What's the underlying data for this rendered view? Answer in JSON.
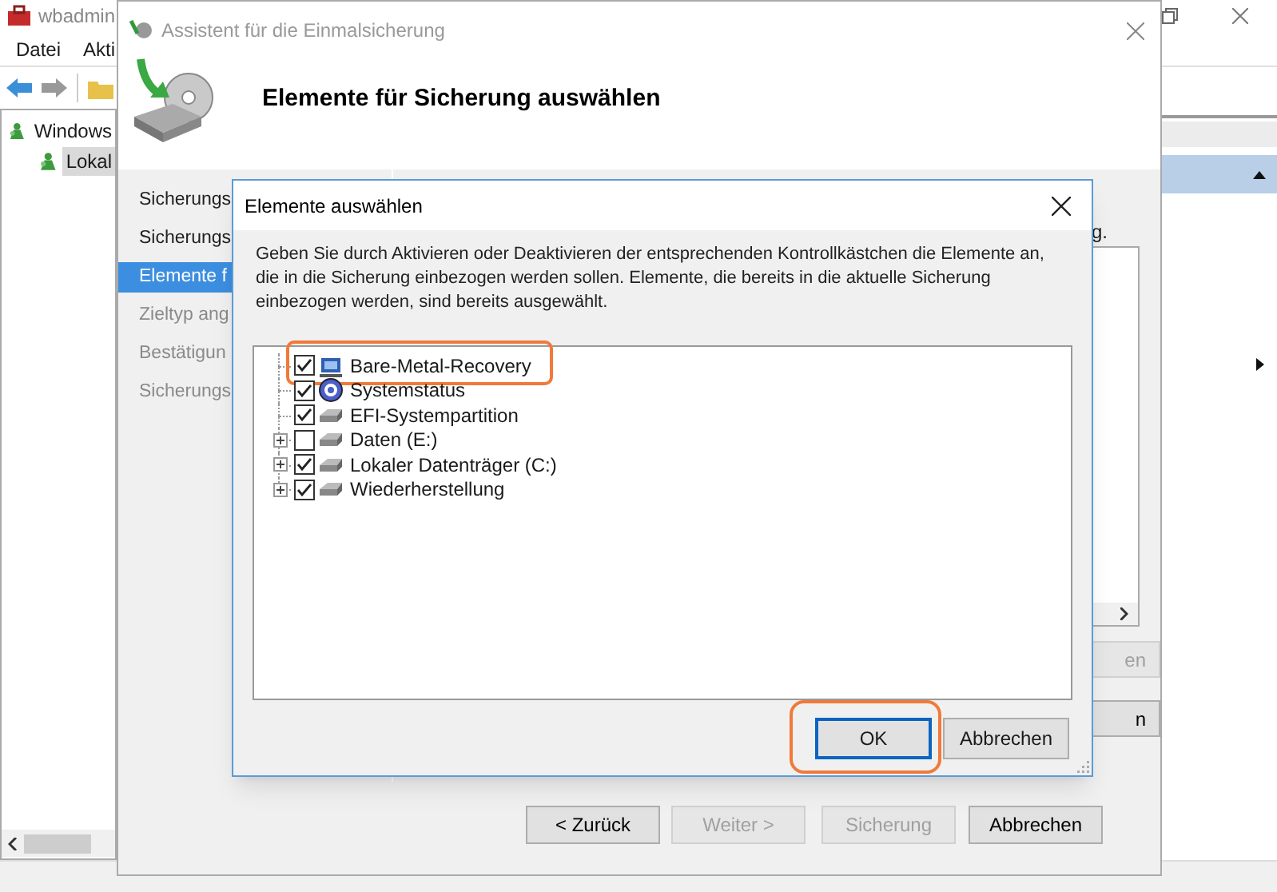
{
  "main_window": {
    "title": "wbadmin",
    "menu": [
      "Datei",
      "Akti"
    ],
    "tree": [
      {
        "label": "Windows",
        "selected": false,
        "children": [
          {
            "label": "Lokal",
            "selected": true
          }
        ]
      }
    ]
  },
  "wizard": {
    "title": "Assistent für die Einmalsicherung",
    "heading": "Elemente für Sicherung auswählen",
    "steps": [
      {
        "label": "Sicherungs",
        "selected": false,
        "disabled": false
      },
      {
        "label": "Sicherungs",
        "selected": false,
        "disabled": false
      },
      {
        "label": "Elemente f",
        "selected": true,
        "disabled": false
      },
      {
        "label": "Zieltyp ang",
        "selected": false,
        "disabled": true
      },
      {
        "label": "Bestätigun",
        "selected": false,
        "disabled": true
      },
      {
        "label": "Sicherungs",
        "selected": false,
        "disabled": true
      }
    ],
    "content_text": "g.",
    "side_buttons": [
      {
        "label": "en",
        "disabled": true
      },
      {
        "label": "n",
        "disabled": false
      }
    ],
    "buttons": [
      {
        "label": "< Zurück",
        "disabled": false
      },
      {
        "label": "Weiter >",
        "disabled": true
      },
      {
        "label": "Sicherung",
        "disabled": true
      },
      {
        "label": "Abbrechen",
        "disabled": false
      }
    ]
  },
  "dialog": {
    "title": "Elemente auswählen",
    "description": "Geben Sie durch Aktivieren oder Deaktivieren der entsprechenden Kontrollkästchen die Elemente an, die in die Sicherung einbezogen werden sollen. Elemente, die bereits in die aktuelle Sicherung einbezogen werden, sind bereits ausgewählt.",
    "items": [
      {
        "label": "Bare-Metal-Recovery",
        "kind": "recovery",
        "checked": true,
        "expandable": false,
        "highlighted": true
      },
      {
        "label": "Systemstatus",
        "kind": "system",
        "checked": true,
        "expandable": false,
        "highlighted": false
      },
      {
        "label": "EFI-Systempartition",
        "kind": "drive",
        "checked": true,
        "expandable": false,
        "highlighted": false
      },
      {
        "label": "Daten (E:)",
        "kind": "drive",
        "checked": false,
        "expandable": true,
        "highlighted": false
      },
      {
        "label": "Lokaler Datenträger (C:)",
        "kind": "drive",
        "checked": true,
        "expandable": true,
        "highlighted": false
      },
      {
        "label": "Wiederherstellung",
        "kind": "drive",
        "checked": true,
        "expandable": true,
        "highlighted": false
      }
    ],
    "buttons": [
      {
        "label": "OK",
        "default": true,
        "highlighted": true
      },
      {
        "label": "Abbrechen",
        "default": false,
        "highlighted": false
      }
    ]
  }
}
